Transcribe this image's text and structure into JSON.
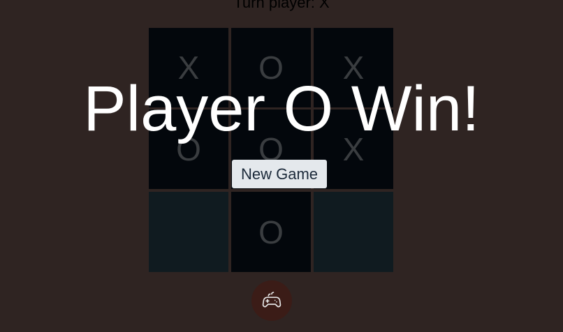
{
  "header": {
    "turn_text": "Turn player: X"
  },
  "board": {
    "cells": [
      [
        "X",
        "O",
        "X"
      ],
      [
        "O",
        "O",
        "X"
      ],
      [
        "",
        "O",
        ""
      ]
    ]
  },
  "result": {
    "message": "Player O Win!",
    "new_game_label": "New Game"
  },
  "controls": {
    "fab_icon": "gamepad-icon"
  },
  "colors": {
    "background": "#2f2422",
    "cell": "#03070c",
    "cell_empty": "#101b20",
    "mark": "#3a3d40",
    "win_text": "#ffffff",
    "button_bg": "#e4e8ec",
    "fab_bg": "#3b1c17"
  }
}
